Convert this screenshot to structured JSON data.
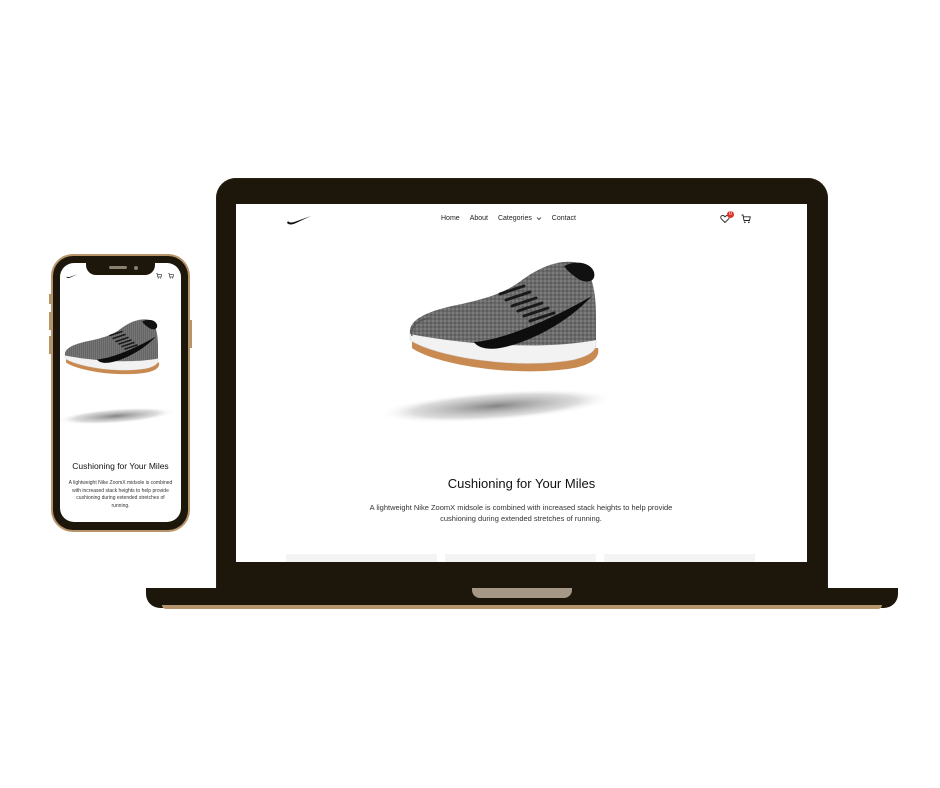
{
  "colors": {
    "device_frame": "#1d160a",
    "device_trim": "#b8946a",
    "badge": "#e0302a"
  },
  "desktop": {
    "nav": {
      "logo_icon": "nike-swoosh-icon",
      "links": [
        "Home",
        "About",
        "Categories",
        "Contact"
      ],
      "categories_dropdown_icon": "chevron-down-icon",
      "wishlist_icon": "heart-icon",
      "wishlist_count": "0",
      "cart_icon": "cart-icon"
    },
    "hero": {
      "title": "Cushioning for Your Miles",
      "description": "A lightweight Nike ZoomX midsole is combined with increased stack heights to help provide cushioning during extended stretches of running."
    }
  },
  "mobile": {
    "nav": {
      "logo_icon": "nike-swoosh-icon",
      "wishlist_icon": "heart-icon",
      "cart_icon": "cart-icon"
    },
    "hero": {
      "title": "Cushioning for Your Miles",
      "description": "A lightweight Nike ZoomX midsole is combined with increased stack heights to help provide cushioning during extended stretches of running."
    }
  }
}
